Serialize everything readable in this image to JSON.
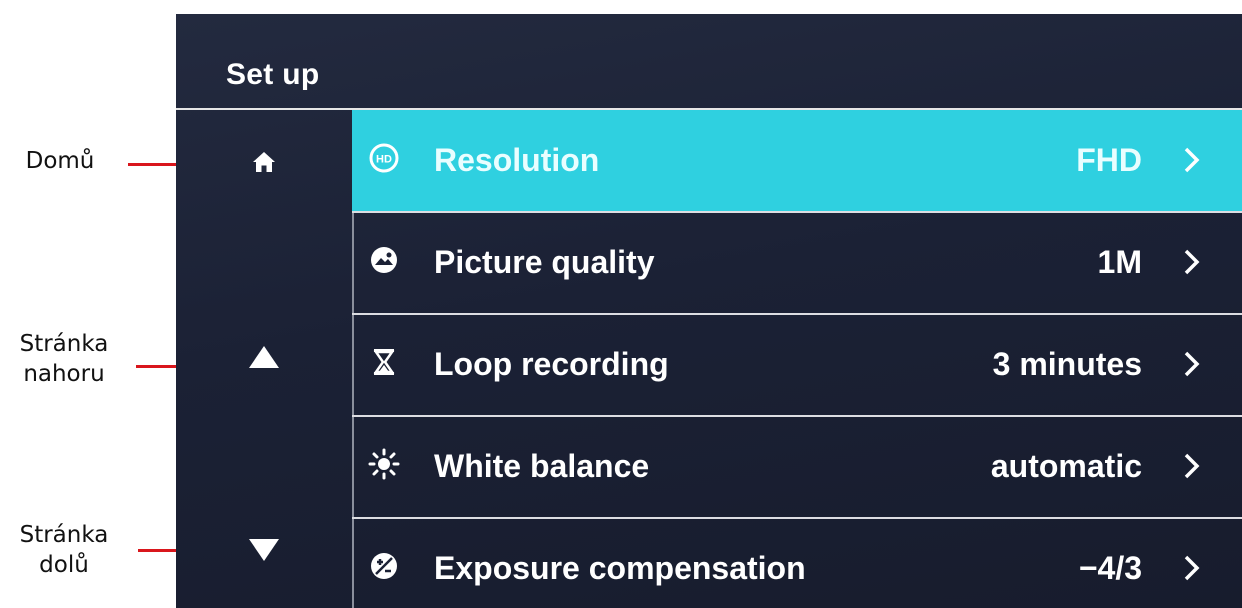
{
  "annotations": {
    "home": "Domů",
    "page_up_line1": "Stránka",
    "page_up_line2": "nahoru",
    "page_down_line1": "Stránka",
    "page_down_line2": "dolů"
  },
  "header": {
    "title": "Set up"
  },
  "sidebar": {
    "items": [
      {
        "icon": "home-icon"
      },
      {
        "icon": "triangle-up-icon"
      },
      {
        "icon": "triangle-down-icon"
      }
    ]
  },
  "menu": {
    "selected_index": 0,
    "items": [
      {
        "icon": "hd-icon",
        "label": "Resolution",
        "value": "FHD"
      },
      {
        "icon": "picture-icon",
        "label": "Picture quality",
        "value": "1M"
      },
      {
        "icon": "hourglass-icon",
        "label": "Loop recording",
        "value": "3 minutes"
      },
      {
        "icon": "sun-icon",
        "label": "White balance",
        "value": "automatic"
      },
      {
        "icon": "exposure-icon",
        "label": "Exposure compensation",
        "value": "−4/3"
      }
    ]
  },
  "colors": {
    "selected_row": "#2fd0e0",
    "background": "#1b2135",
    "annotation_line": "#d9161c"
  }
}
